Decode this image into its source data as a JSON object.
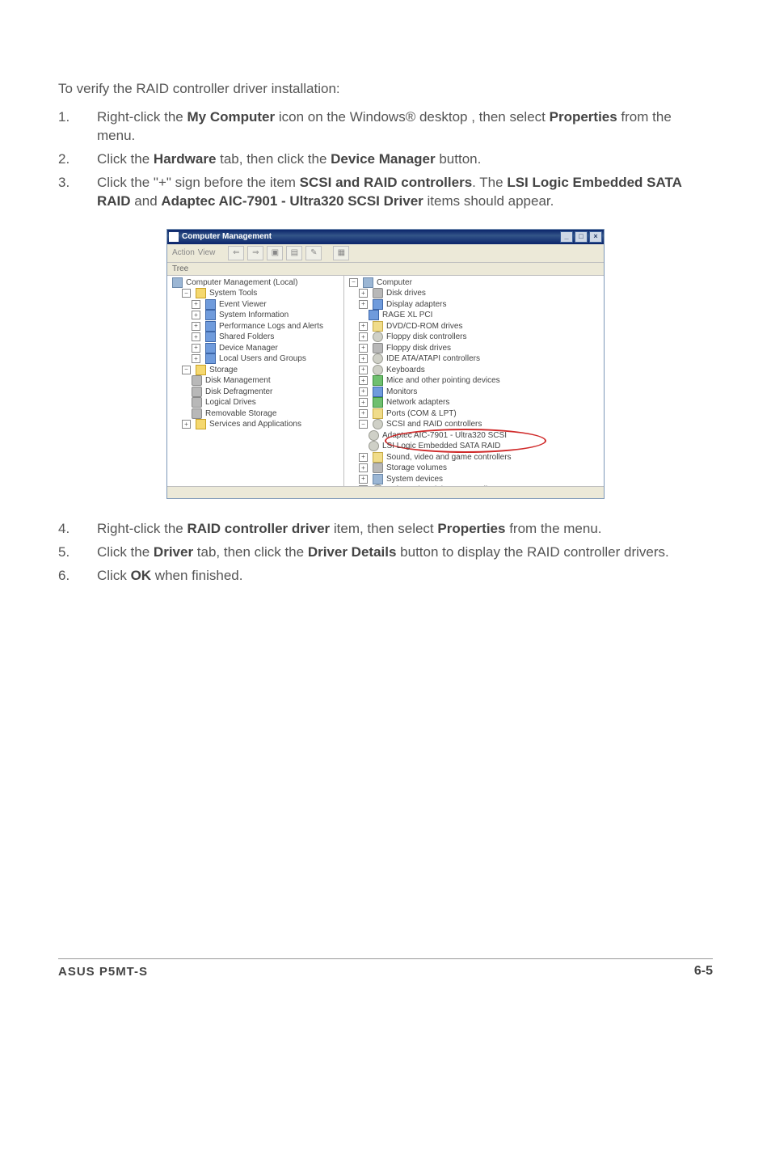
{
  "intro": "To verify the RAID controller driver installation:",
  "steps_top": [
    {
      "parts": [
        {
          "t": "Right-click the "
        },
        {
          "t": "My Computer",
          "b": true
        },
        {
          "t": " icon on the Windows® desktop , then select "
        },
        {
          "t": "Properties",
          "b": true
        },
        {
          "t": " from the menu."
        }
      ]
    },
    {
      "parts": [
        {
          "t": "Click the "
        },
        {
          "t": "Hardware",
          "b": true
        },
        {
          "t": " tab, then click the "
        },
        {
          "t": "Device Manager",
          "b": true
        },
        {
          "t": " button."
        }
      ]
    },
    {
      "parts": [
        {
          "t": "Click the \"+\" sign before the item "
        },
        {
          "t": "SCSI and RAID controllers",
          "b": true
        },
        {
          "t": ". The "
        },
        {
          "t": "LSI Logic Embedded SATA RAID",
          "b": true
        },
        {
          "t": " and "
        },
        {
          "t": "Adaptec AIC-7901 - Ultra320 SCSI Driver",
          "b": true
        },
        {
          "t": " items should appear."
        }
      ]
    }
  ],
  "steps_bottom": [
    {
      "parts": [
        {
          "t": "Right-click the "
        },
        {
          "t": "RAID controller driver",
          "b": true
        },
        {
          "t": " item, then select "
        },
        {
          "t": "Properties",
          "b": true
        },
        {
          "t": " from the menu."
        }
      ]
    },
    {
      "parts": [
        {
          "t": "Click the "
        },
        {
          "t": "Driver",
          "b": true
        },
        {
          "t": " tab, then click the "
        },
        {
          "t": "Driver Details",
          "b": true
        },
        {
          "t": " button to display the RAID controller drivers."
        }
      ]
    },
    {
      "parts": [
        {
          "t": "Click "
        },
        {
          "t": "OK",
          "b": true
        },
        {
          "t": " when finished."
        }
      ]
    }
  ],
  "win": {
    "title": "Computer Management",
    "menu": {
      "action": "Action",
      "view": "View"
    },
    "header_left": "Tree",
    "left_tree": {
      "root": "Computer Management (Local)",
      "groups": [
        {
          "label": "System Tools",
          "children": [
            "Event Viewer",
            "System Information",
            "Performance Logs and Alerts",
            "Shared Folders",
            "Device Manager",
            "Local Users and Groups"
          ]
        },
        {
          "label": "Storage",
          "children": [
            "Disk Management",
            "Disk Defragmenter",
            "Logical Drives",
            "Removable Storage"
          ]
        },
        {
          "label": "Services and Applications",
          "children": []
        }
      ]
    },
    "right_tree": {
      "root": "Computer",
      "items": [
        "Disk drives",
        "Display adapters",
        "RAGE XL   PCI",
        "DVD/CD-ROM drives",
        "Floppy disk controllers",
        "Floppy disk drives",
        "IDE ATA/ATAPI controllers",
        "Keyboards",
        "Mice and other pointing devices",
        "Monitors",
        "Network adapters",
        "Ports (COM & LPT)",
        "SCSI and RAID controllers",
        "Adaptec AIC-7901 - Ultra320 SCSI",
        "LSI Logic Embedded SATA RAID",
        "Sound, video and game controllers",
        "Storage volumes",
        "System devices",
        "Universal Serial Bus controllers"
      ]
    }
  },
  "footer": {
    "left": "ASUS P5MT-S",
    "right": "6-5"
  }
}
